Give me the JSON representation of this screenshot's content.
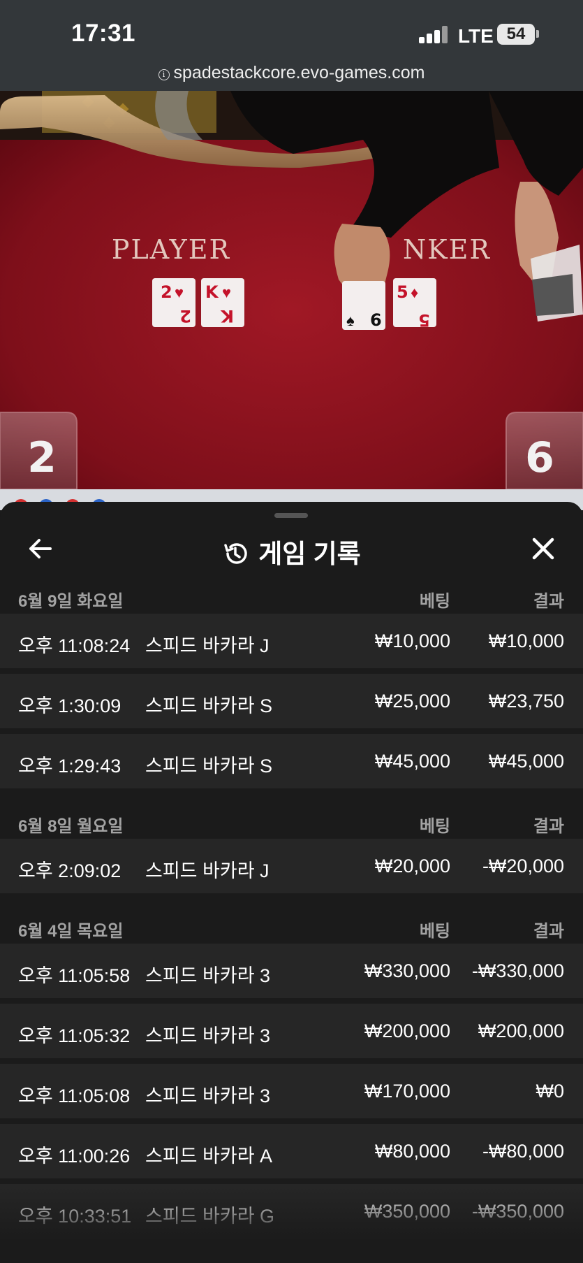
{
  "status_bar": {
    "time": "17:31",
    "network": "LTE",
    "battery": "54"
  },
  "browser": {
    "url": "spadestackcore.evo-games.com"
  },
  "video": {
    "player_label": "PLAYER",
    "banker_label": "NKER",
    "player_score": "2",
    "banker_score": "6"
  },
  "sheet": {
    "title": "게임 기록",
    "groups": [
      {
        "date": "6월 9일 화요일",
        "bet_header": "베팅",
        "result_header": "결과",
        "rows": [
          {
            "time": "오후 11:08:24",
            "game": "스피드 바카라 J",
            "bet": "₩10,000",
            "result": "₩10,000"
          },
          {
            "time": "오후 1:30:09",
            "game": "스피드 바카라 S",
            "bet": "₩25,000",
            "result": "₩23,750"
          },
          {
            "time": "오후 1:29:43",
            "game": "스피드 바카라 S",
            "bet": "₩45,000",
            "result": "₩45,000"
          }
        ]
      },
      {
        "date": "6월 8일 월요일",
        "bet_header": "베팅",
        "result_header": "결과",
        "rows": [
          {
            "time": "오후 2:09:02",
            "game": "스피드 바카라 J",
            "bet": "₩20,000",
            "result": "-₩20,000"
          }
        ]
      },
      {
        "date": "6월 4일 목요일",
        "bet_header": "베팅",
        "result_header": "결과",
        "rows": [
          {
            "time": "오후 11:05:58",
            "game": "스피드 바카라 3",
            "bet": "₩330,000",
            "result": "-₩330,000"
          },
          {
            "time": "오후 11:05:32",
            "game": "스피드 바카라 3",
            "bet": "₩200,000",
            "result": "₩200,000"
          },
          {
            "time": "오후 11:05:08",
            "game": "스피드 바카라 3",
            "bet": "₩170,000",
            "result": "₩0"
          },
          {
            "time": "오후 11:00:26",
            "game": "스피드 바카라 A",
            "bet": "₩80,000",
            "result": "-₩80,000"
          },
          {
            "time": "오후 10:33:51",
            "game": "스피드 바카라 G",
            "bet": "₩350,000",
            "result": "-₩350,000"
          }
        ]
      }
    ]
  }
}
